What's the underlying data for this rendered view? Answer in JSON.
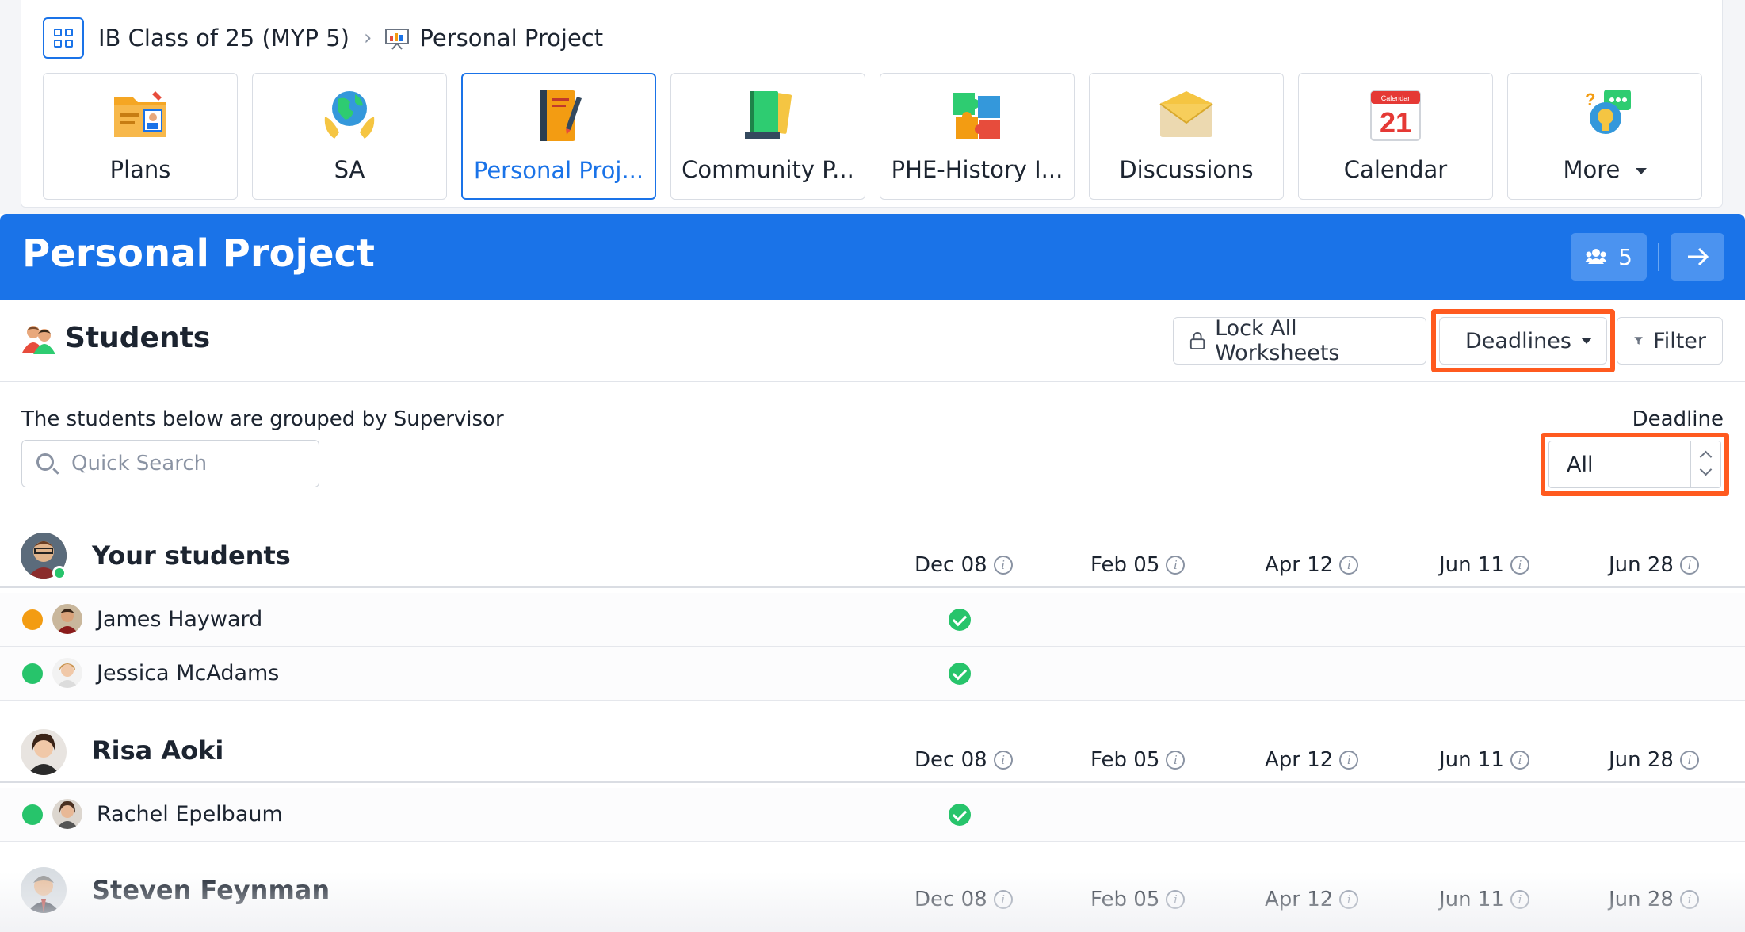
{
  "breadcrumb": {
    "class_name": "IB Class of 25 (MYP 5)",
    "current": "Personal Project"
  },
  "tiles": [
    {
      "label": "Plans",
      "icon": "folder-plans-icon"
    },
    {
      "label": "SA",
      "icon": "globe-hands-icon"
    },
    {
      "label": "Personal Proj...",
      "icon": "notebook-pen-icon",
      "active": true
    },
    {
      "label": "Community P...",
      "icon": "books-icon"
    },
    {
      "label": "PHE-History I...",
      "icon": "puzzle-icon"
    },
    {
      "label": "Discussions",
      "icon": "envelope-icon"
    },
    {
      "label": "Calendar",
      "icon": "calendar-icon",
      "calendar_day": "21",
      "calendar_header": "Calendar"
    },
    {
      "label": "More",
      "icon": "chat-lightbulb-icon"
    }
  ],
  "header": {
    "title": "Personal Project",
    "member_count": "5"
  },
  "toolbar": {
    "section_title": "Students",
    "lock_label": "Lock All Worksheets",
    "deadlines_label": "Deadlines",
    "filter_label": "Filter"
  },
  "info": {
    "group_note": "The students below are grouped by Supervisor",
    "search_placeholder": "Quick Search",
    "deadline_label": "Deadline",
    "deadline_value": "All"
  },
  "deadline_columns": [
    "Dec 08",
    "Feb 05",
    "Apr 12",
    "Jun 11",
    "Jun 28"
  ],
  "groups": [
    {
      "name": "Your students",
      "online": true,
      "students": [
        {
          "name": "James Hayward",
          "badge": "orange",
          "completed": [
            true,
            false,
            false,
            false,
            false
          ]
        },
        {
          "name": "Jessica McAdams",
          "badge": "green",
          "completed": [
            true,
            false,
            false,
            false,
            false
          ]
        }
      ]
    },
    {
      "name": "Risa Aoki",
      "students": [
        {
          "name": "Rachel Epelbaum",
          "badge": "green",
          "completed": [
            true,
            false,
            false,
            false,
            false
          ]
        }
      ]
    },
    {
      "name": "Steven Feynman",
      "students": []
    }
  ],
  "colors": {
    "accent": "#1a73e8",
    "highlight": "#ff5a1f",
    "success": "#27c46b",
    "warning": "#f39c12"
  }
}
